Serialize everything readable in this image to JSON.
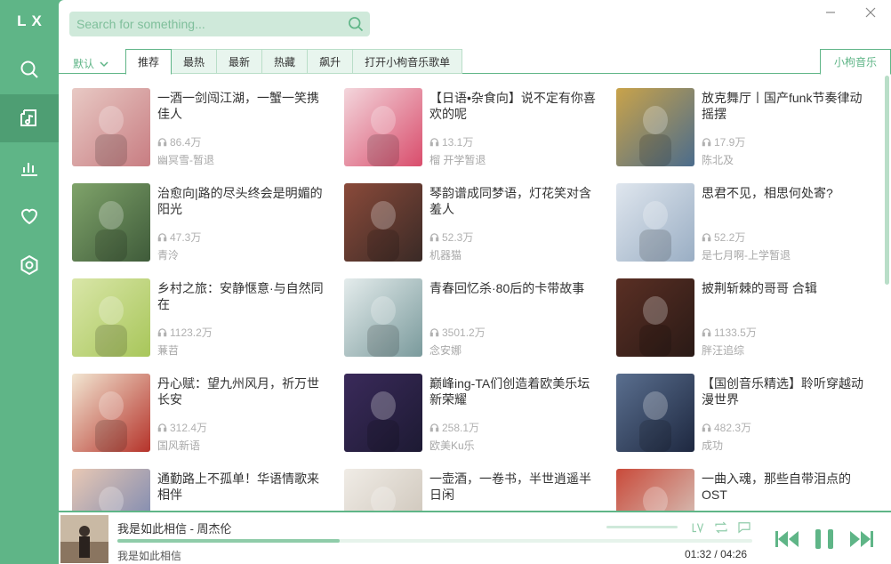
{
  "sidebar": {
    "logo": "LX",
    "items": [
      {
        "name": "search",
        "icon": "search-icon"
      },
      {
        "name": "song-list",
        "icon": "music-folder-icon",
        "active": true
      },
      {
        "name": "leaderboard",
        "icon": "bar-chart-icon"
      },
      {
        "name": "favorites",
        "icon": "heart-icon"
      },
      {
        "name": "settings",
        "icon": "settings-hex-icon"
      }
    ]
  },
  "search": {
    "placeholder": "Search for something..."
  },
  "tabs": {
    "sort_label": "默认",
    "items": [
      "推荐",
      "最热",
      "最新",
      "热藏",
      "飙升",
      "打开小枸音乐歌单"
    ],
    "active": 0,
    "source": "小枸音乐"
  },
  "playlists": [
    {
      "title": "一酒一剑闯江湖，一蟹一笑携佳人",
      "plays": "86.4万",
      "author": "幽冥雪-暂退",
      "cover": [
        "#e8c9c4",
        "#c87d82"
      ]
    },
    {
      "title": "【日语•杂食向】说不定有你喜欢的呢",
      "plays": "13.1万",
      "author": "榴 开学暂退",
      "cover": [
        "#f3d6dc",
        "#d94d6c"
      ]
    },
    {
      "title": "放克舞厅丨国产funk节奏律动摇摆",
      "plays": "17.9万",
      "author": "陈北及",
      "cover": [
        "#c9a34a",
        "#4b6c8c"
      ]
    },
    {
      "title": "治愈向|路的尽头终会是明媚的阳光",
      "plays": "47.3万",
      "author": "青泠",
      "cover": [
        "#7fa36a",
        "#3f5b3a"
      ]
    },
    {
      "title": "琴韵谱成同梦语，灯花笑对含羞人",
      "plays": "52.3万",
      "author": "机器猫",
      "cover": [
        "#8a4a3a",
        "#3a2a26"
      ]
    },
    {
      "title": "思君不见，相思何处寄?",
      "plays": "52.2万",
      "author": "是七月啊-上学暂退",
      "cover": [
        "#dfe6ee",
        "#9aaec4"
      ]
    },
    {
      "title": "乡村之旅：安静惬意·与自然同在",
      "plays": "1123.2万",
      "author": "蒹苕",
      "cover": [
        "#d9e6a8",
        "#a8c65a"
      ]
    },
    {
      "title": "青春回忆杀·80后的卡带故事",
      "plays": "3501.2万",
      "author": "念安娜",
      "cover": [
        "#e4ecec",
        "#7a9a9c"
      ]
    },
    {
      "title": "披荆斩棘的哥哥 合辑",
      "plays": "1133.5万",
      "author": "胖汪追综",
      "cover": [
        "#5a2f24",
        "#2a1a16"
      ]
    },
    {
      "title": "丹心赋：望九州风月，祈万世长安",
      "plays": "312.4万",
      "author": "国风新语",
      "cover": [
        "#f2e6d2",
        "#b5332a"
      ]
    },
    {
      "title": "巅峰ing-TA们创造着欧美乐坛新荣耀",
      "plays": "258.1万",
      "author": "欧美Ku乐",
      "cover": [
        "#3a2a5a",
        "#1d1a33"
      ]
    },
    {
      "title": "【国创音乐精选】聆听穿越动漫世界",
      "plays": "482.3万",
      "author": "成功",
      "cover": [
        "#5a6f8f",
        "#1e2840"
      ]
    },
    {
      "title": "通勤路上不孤单！华语情歌来相伴",
      "plays": "",
      "author": "",
      "cover": [
        "#e8c8b4",
        "#6b7fb0"
      ]
    },
    {
      "title": "一壶酒，一卷书，半世逍遥半日闲",
      "plays": "",
      "author": "",
      "cover": [
        "#f0ece6",
        "#c9c0b4"
      ]
    },
    {
      "title": "一曲入魂，那些自带泪点的OST",
      "plays": "",
      "author": "",
      "cover": [
        "#c94a3a",
        "#d8d4cc"
      ]
    }
  ],
  "player": {
    "title": "我是如此相信 - 周杰伦",
    "lyric": "我是如此相信",
    "current_time": "01:32",
    "total_time": "04:26",
    "progress": 0.35,
    "volume": 1.0,
    "sep": "/",
    "icons": [
      "lyric-icon",
      "repeat-icon",
      "comment-icon",
      "prev-icon",
      "pause-icon",
      "next-icon"
    ]
  },
  "colors": {
    "accent": "#5fb587",
    "accent_dark": "#4e9e73",
    "tab_bg": "#e8f5ee"
  }
}
